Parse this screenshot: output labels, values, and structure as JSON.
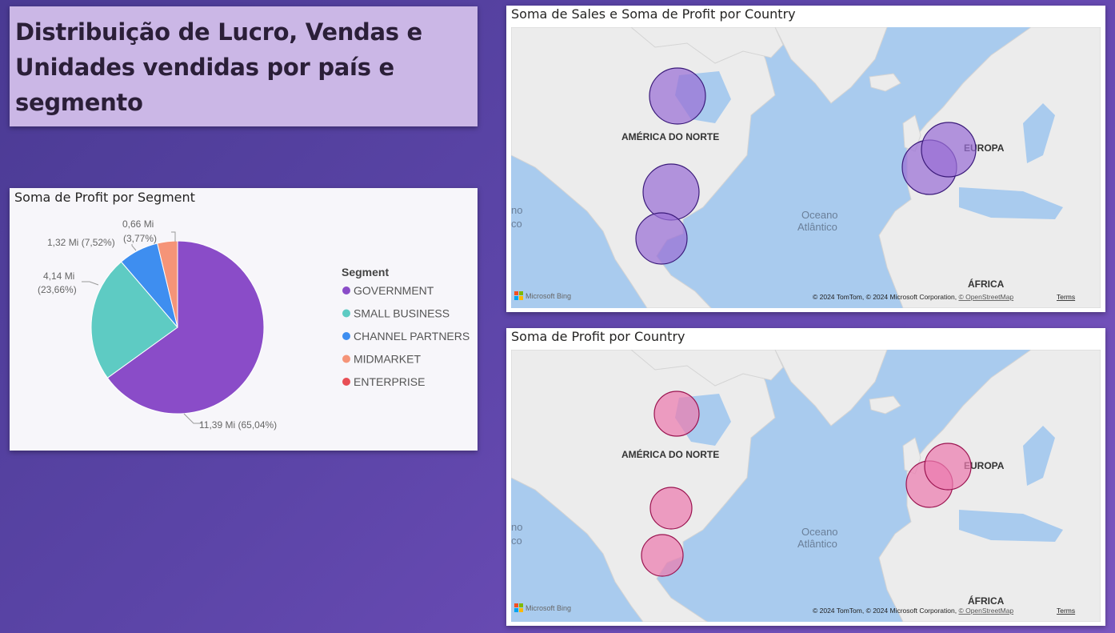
{
  "page": {
    "title": "Distribuição de Lucro, Vendas e Unidades vendidas por país e segmento"
  },
  "pie_card": {
    "title": "Soma de Profit por Segment",
    "legend_title": "Segment",
    "slice_labels": [
      {
        "value": "11,39 Mi",
        "pct": "(65,04%)"
      },
      {
        "value": "4,14 Mi",
        "pct": "(23,66%)"
      },
      {
        "value": "1,32 Mi",
        "pct": "(7,52%)"
      },
      {
        "value": "0,66 Mi",
        "pct": "(3,77%)"
      }
    ]
  },
  "chart_data": {
    "type": "pie",
    "title": "Soma de Profit por Segment",
    "legend_title": "Segment",
    "categories": [
      "GOVERNMENT",
      "SMALL BUSINESS",
      "CHANNEL PARTNERS",
      "MIDMARKET",
      "ENTERPRISE"
    ],
    "values": [
      11.39,
      4.14,
      1.32,
      0.66,
      0
    ],
    "percentages": [
      65.04,
      23.66,
      7.52,
      3.77,
      0
    ],
    "unit": "Mi",
    "colors": [
      "#8a4cc8",
      "#5ecbc3",
      "#3e8ef0",
      "#f59478",
      "#e84f55"
    ],
    "legend_placement": "right"
  },
  "map_top": {
    "title": "Soma de Sales e Soma de Profit por Country",
    "bubble_color": "#9a6fd6",
    "bubble_stroke": "#3b1b7a"
  },
  "map_bottom": {
    "title": "Soma de Profit por Country",
    "bubble_color": "#ec7cae",
    "bubble_stroke": "#9b1450"
  },
  "map_labels": {
    "north_america": "AMÉRICA DO NORTE",
    "europe": "EUROPA",
    "africa": "ÁFRICA",
    "ocean_line1": "Oceano",
    "ocean_line2": "Atlântico",
    "edge_line1": "no",
    "edge_line2": "co",
    "bing": "Microsoft Bing",
    "attribution": "© 2024 TomTom, © 2024 Microsoft Corporation, ",
    "osm_link": "© OpenStreetMap",
    "terms": "Terms"
  }
}
